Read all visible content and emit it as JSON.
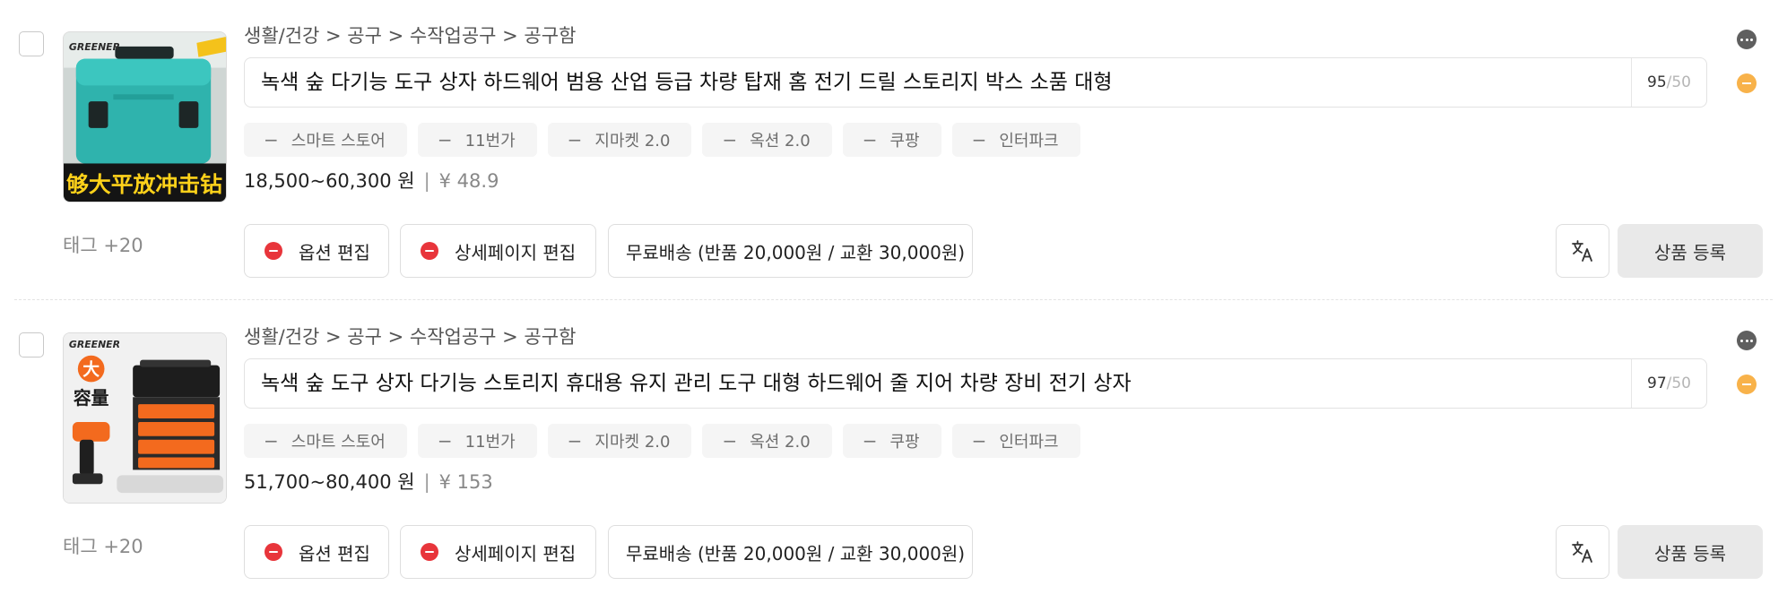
{
  "products": [
    {
      "breadcrumb": "생활/건강 > 공구 > 수작업공구 > 공구함",
      "title": "녹색 숲 다기능 도구 상자 하드웨어 범용 산업 등급 차량 탑재 홈 전기 드릴 스토리지 박스 소품 대형",
      "title_count": "95",
      "title_max": "/50",
      "markets": [
        "스마트 스토어",
        "11번가",
        "지마켓 2.0",
        "옥션 2.0",
        "쿠팡",
        "인터파크"
      ],
      "price_krw": "18,500~60,300 원",
      "price_sep": "|",
      "price_cny": "¥ 48.9",
      "tag_count": "태그 +20",
      "option_edit": "옵션 편집",
      "detail_edit": "상세페이지 편집",
      "shipping": "무료배송 (반품 20,000원 / 교환 30,000원)",
      "register": "상품 등록",
      "image": {
        "brand": "GREENER",
        "caption": "够大平放冲击钻"
      }
    },
    {
      "breadcrumb": "생활/건강 > 공구 > 수작업공구 > 공구함",
      "title": "녹색 숲 도구 상자 다기능 스토리지 휴대용 유지 관리 도구 대형 하드웨어 줄 지어 차량 장비 전기 상자",
      "title_count": "97",
      "title_max": "/50",
      "markets": [
        "스마트 스토어",
        "11번가",
        "지마켓 2.0",
        "옥션 2.0",
        "쿠팡",
        "인터파크"
      ],
      "price_krw": "51,700~80,400 원",
      "price_sep": "|",
      "price_cny": "¥ 153",
      "tag_count": "태그 +20",
      "option_edit": "옵션 편집",
      "detail_edit": "상세페이지 편집",
      "shipping": "무료배송 (반품 20,000원 / 교환 30,000원)",
      "register": "상품 등록",
      "image": {
        "brand": "GREENER",
        "badge": "大",
        "caption": "容量"
      }
    }
  ],
  "icons": {
    "more": "more-icon",
    "warning": "warning-icon",
    "translate": "translate-icon",
    "remove": "remove-icon"
  },
  "colors": {
    "accent_red": "#e8353b",
    "warning": "#f8b24a",
    "register_bg": "#e9e9e9"
  }
}
